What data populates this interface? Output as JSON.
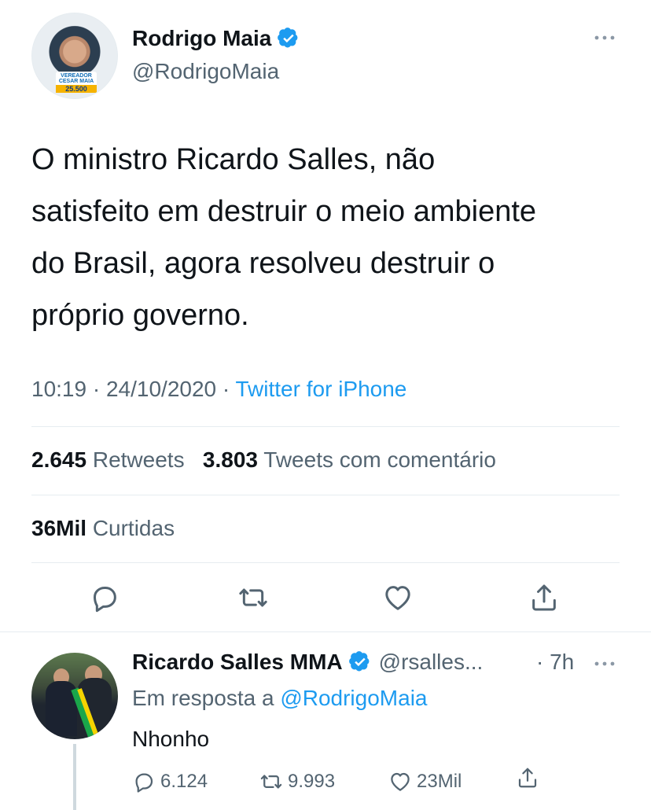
{
  "main_tweet": {
    "author_name": "Rodrigo Maia",
    "author_handle": "@RodrigoMaia",
    "avatar_badge_top": "VEREADOR CESAR MAIA",
    "avatar_badge_number": "25.500",
    "text": "O ministro Ricardo Salles, não\nsatisfeito em destruir o meio ambiente\ndo Brasil, agora resolveu destruir o\npróprio governo.",
    "time": "10:19",
    "date": "24/10/2020",
    "source": "Twitter for iPhone",
    "retweets_count": "2.645",
    "retweets_label": "Retweets",
    "quotes_count": "3.803",
    "quotes_label": "Tweets com comentário",
    "likes_count": "36Mil",
    "likes_label": "Curtidas"
  },
  "reply_tweet": {
    "author_name": "Ricardo Salles MMA",
    "author_handle": "@rsalles...",
    "time": "· 7h",
    "reply_prefix": "Em resposta a",
    "reply_mention": "@RodrigoMaia",
    "text": "Nhonho",
    "reply_count": "6.124",
    "retweet_count": "9.993",
    "like_count": "23Mil"
  },
  "colors": {
    "accent": "#1d9bf0",
    "text_primary": "#0f1419",
    "text_secondary": "#536471",
    "divider": "#e6ecf0"
  },
  "icons": {
    "verified": "verified-badge-icon",
    "more": "more-dots-icon",
    "reply": "reply-icon",
    "retweet": "retweet-icon",
    "like": "heart-icon",
    "share": "share-icon"
  }
}
